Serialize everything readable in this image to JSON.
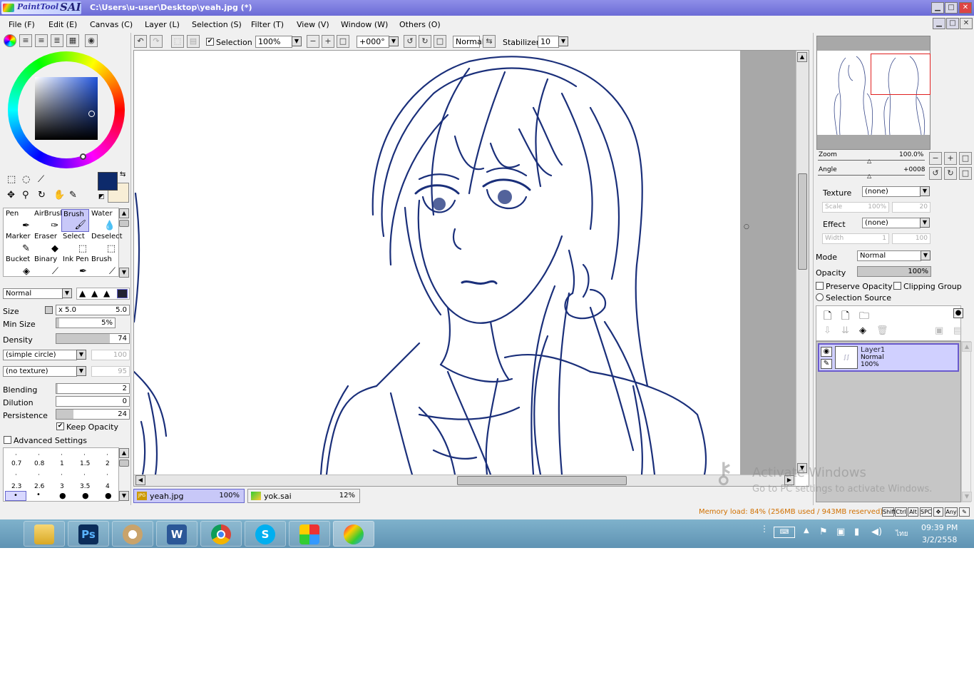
{
  "window": {
    "app_name_small": "PaintTool",
    "app_name_big": "SAI",
    "title": "C:\\Users\\u-user\\Desktop\\yeah.jpg (*)",
    "min": "▁",
    "max": "□",
    "close": "✕"
  },
  "menu": [
    {
      "label": "File (F)"
    },
    {
      "label": "Edit (E)"
    },
    {
      "label": "Canvas (C)"
    },
    {
      "label": "Layer (L)"
    },
    {
      "label": "Selection (S)"
    },
    {
      "label": "Filter (T)"
    },
    {
      "label": "View (V)"
    },
    {
      "label": "Window (W)"
    },
    {
      "label": "Others (O)"
    }
  ],
  "toolbar": {
    "selection_label": "Selection",
    "selection_checked": true,
    "zoom": "100%",
    "angle": "+000°",
    "blend_mode": "Normal",
    "stabilizer_label": "Stabilizer",
    "stabilizer_value": "10"
  },
  "tools": [
    {
      "name": "Pen",
      "icon": "pen-icon"
    },
    {
      "name": "AirBrush",
      "icon": "airbrush-icon"
    },
    {
      "name": "Brush",
      "icon": "brush-icon",
      "selected": true
    },
    {
      "name": "Water",
      "icon": "water-icon"
    },
    {
      "name": "Marker",
      "icon": "marker-icon"
    },
    {
      "name": "Eraser",
      "icon": "eraser-icon"
    },
    {
      "name": "Select",
      "icon": "select-icon"
    },
    {
      "name": "Deselect",
      "icon": "deselect-icon"
    },
    {
      "name": "Bucket",
      "icon": "bucket-icon"
    },
    {
      "name": "Binary",
      "icon": "binary-icon"
    },
    {
      "name": "Ink Pen",
      "icon": "ink-pen-icon"
    },
    {
      "name": "Brush",
      "icon": "brush-icon"
    }
  ],
  "colors": {
    "primary": "#0d2a6b",
    "secondary": "#f8eed6"
  },
  "brush": {
    "mode": "Normal",
    "size_label": "Size",
    "size_mult": "x 5.0",
    "size_value": "5.0",
    "min_size_label": "Min Size",
    "min_size_value": "5%",
    "min_size": 0.05,
    "density_label": "Density",
    "density_value": "74",
    "density": 0.74,
    "shape": "(simple circle)",
    "shape_value": "100",
    "texture": "(no texture)",
    "texture_value": "95",
    "blending_label": "Blending",
    "blending_value": "2",
    "blending": 0.02,
    "dilution_label": "Dilution",
    "dilution_value": "0",
    "dilution": 0,
    "persistence_label": "Persistence",
    "persistence_value": "24",
    "persistence": 0.24,
    "keep_opacity_label": "Keep Opacity",
    "keep_opacity": true,
    "advanced_label": "Advanced Settings",
    "advanced": false
  },
  "brush_sizes": [
    {
      "label": "0.7"
    },
    {
      "label": "0.8"
    },
    {
      "label": "1"
    },
    {
      "label": "1.5"
    },
    {
      "label": "2"
    },
    {
      "label": "2.3"
    },
    {
      "label": "2.6"
    },
    {
      "label": "3"
    },
    {
      "label": "3.5"
    },
    {
      "label": "4"
    }
  ],
  "navigator": {
    "zoom_label": "Zoom",
    "zoom_value": "100.0%",
    "angle_label": "Angle",
    "angle_value": "+0008"
  },
  "layer_props": {
    "texture_label": "Texture",
    "texture_value": "(none)",
    "scale_label": "Scale",
    "scale_value": "100%",
    "scale_value2": "20",
    "effect_label": "Effect",
    "effect_value": "(none)",
    "width_label": "Width",
    "width_value": "1",
    "width_value2": "100",
    "mode_label": "Mode",
    "mode_value": "Normal",
    "opacity_label": "Opacity",
    "opacity_value": "100%",
    "opacity": 1.0,
    "preserve_opacity_label": "Preserve Opacity",
    "clipping_group_label": "Clipping Group",
    "selection_source_label": "Selection Source"
  },
  "layers": [
    {
      "name": "Layer1",
      "mode": "Normal",
      "opacity": "100%"
    }
  ],
  "documents": [
    {
      "name": "yeah.jpg",
      "zoom": "100%",
      "active": true
    },
    {
      "name": "yok.sai",
      "zoom": "12%",
      "active": false
    }
  ],
  "status": {
    "memory": "Memory load: 84% (256MB used / 943MB reserved)",
    "keys": [
      "Shift",
      "Ctrl",
      "Alt",
      "SPC",
      "Any"
    ]
  },
  "watermark": {
    "title": "Activate Windows",
    "subtitle": "Go to PC settings to activate Windows."
  },
  "taskbar": {
    "apps": [
      {
        "name": "file-explorer",
        "icon": "folder-icon"
      },
      {
        "name": "photoshop",
        "icon": "photoshop-icon",
        "text": "Ps"
      },
      {
        "name": "paint",
        "icon": "palette-icon"
      },
      {
        "name": "word",
        "icon": "word-icon",
        "text": "W"
      },
      {
        "name": "chrome",
        "icon": "chrome-icon"
      },
      {
        "name": "skype",
        "icon": "skype-icon",
        "text": "S"
      },
      {
        "name": "app-grid",
        "icon": "grid-app-icon"
      },
      {
        "name": "paint-tool-sai",
        "icon": "sai-icon",
        "active": true
      }
    ],
    "language": "ไทย",
    "time": "09:39 PM",
    "date": "3/2/2558"
  }
}
